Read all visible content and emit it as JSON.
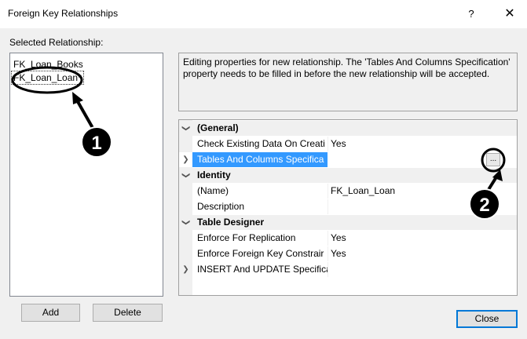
{
  "window": {
    "title": "Foreign Key Relationships",
    "help": "?",
    "close": "✕"
  },
  "left": {
    "selected_label": "Selected Relationship:",
    "relationships": [
      "FK_Loan_Books",
      "FK_Loan_Loan*"
    ],
    "add_label": "Add",
    "delete_label": "Delete"
  },
  "description": "Editing properties for new relationship.  The 'Tables And Columns Specification' property needs to be filled in before the new relationship will be accepted.",
  "properties": {
    "general_header": "(General)",
    "check_existing_name": "Check Existing Data On Creati",
    "check_existing_value": "Yes",
    "tables_columns_name": "Tables And Columns Specifica",
    "tables_columns_value": "",
    "ellipsis": "...",
    "identity_header": "Identity",
    "name_name": "(Name)",
    "name_value": "FK_Loan_Loan",
    "description_name": "Description",
    "description_value": "",
    "table_designer_header": "Table Designer",
    "enforce_replication_name": "Enforce For Replication",
    "enforce_replication_value": "Yes",
    "enforce_fk_name": "Enforce Foreign Key Constrair",
    "enforce_fk_value": "Yes",
    "insert_update_name": "INSERT And UPDATE Specifica",
    "insert_update_value": ""
  },
  "footer": {
    "close_label": "Close"
  },
  "callouts": {
    "one": "1",
    "two": "2"
  },
  "icons": {
    "expanded": "chevron-down-icon",
    "collapsed": "chevron-right-icon"
  }
}
